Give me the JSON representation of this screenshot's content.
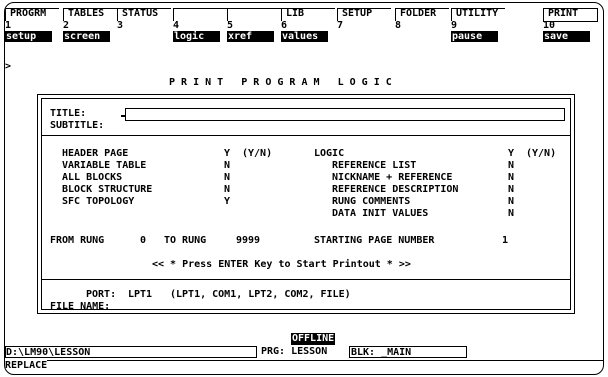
{
  "fkeys": [
    {
      "top": "PROGRM",
      "num": "1",
      "label": "setup"
    },
    {
      "top": "TABLES",
      "num": "2",
      "label": "screen"
    },
    {
      "top": "STATUS",
      "num": "3",
      "label": ""
    },
    {
      "top": "",
      "num": "4",
      "label": "logic"
    },
    {
      "top": "",
      "num": "5",
      "label": "xref"
    },
    {
      "top": "LIB",
      "num": "6",
      "label": "values"
    },
    {
      "top": "SETUP",
      "num": "7",
      "label": ""
    },
    {
      "top": "FOLDER",
      "num": "8",
      "label": ""
    },
    {
      "top": "UTILITY",
      "num": "9",
      "label": "pause"
    },
    {
      "top": "PRINT",
      "num": "10",
      "label": "save"
    }
  ],
  "prompt": ">",
  "screen_title": "P R I N T   P R O G R A M   L O G I C",
  "title_label": "TITLE:",
  "title_value": "",
  "subtitle_label": "SUBTITLE:",
  "left_options": [
    {
      "label": "HEADER PAGE",
      "value": "Y",
      "hint": "(Y/N)"
    },
    {
      "label": "VARIABLE TABLE",
      "value": "N",
      "hint": ""
    },
    {
      "label": "ALL BLOCKS",
      "value": "N",
      "hint": ""
    },
    {
      "label": "BLOCK STRUCTURE",
      "value": "N",
      "hint": ""
    },
    {
      "label": "SFC TOPOLOGY",
      "value": "Y",
      "hint": ""
    }
  ],
  "logic_label": "LOGIC",
  "logic_value": "Y",
  "logic_hint": "(Y/N)",
  "right_options": [
    {
      "label": "REFERENCE LIST",
      "value": "N"
    },
    {
      "label": "NICKNAME + REFERENCE",
      "value": "N"
    },
    {
      "label": "REFERENCE DESCRIPTION",
      "value": "N"
    },
    {
      "label": "RUNG COMMENTS",
      "value": "N"
    },
    {
      "label": "DATA INIT VALUES",
      "value": "N"
    }
  ],
  "from_rung_label": "FROM RUNG",
  "from_rung_value": "0",
  "to_rung_label": "TO RUNG",
  "to_rung_value": "9999",
  "start_page_label": "STARTING PAGE NUMBER",
  "start_page_value": "1",
  "enter_message": "<< * Press ENTER Key to Start Printout * >>",
  "port_label": "PORT:",
  "port_value": "LPT1",
  "port_options": "(LPT1, COM1, LPT2, COM2, FILE)",
  "file_name_label": "FILE NAME:",
  "status": {
    "mode": "OFFLINE",
    "path": "D:\\LM90\\LESSON",
    "program": "PRG: LESSON",
    "block": "BLK: _MAIN",
    "edit_mode": "REPLACE"
  }
}
